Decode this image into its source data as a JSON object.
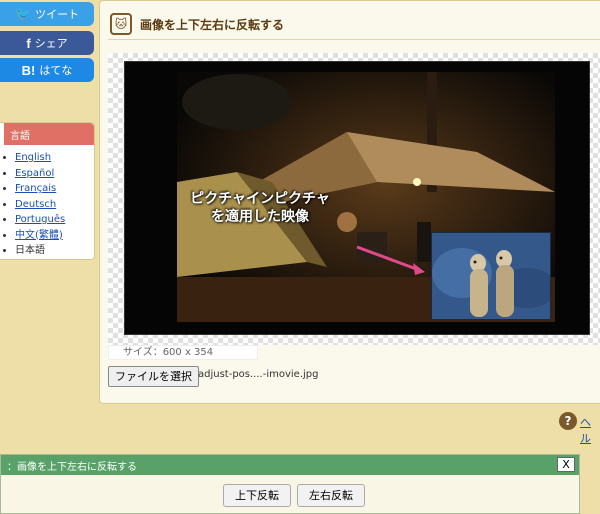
{
  "social": {
    "tweet": "ツイート",
    "share": "シェア",
    "hatena": "はてな"
  },
  "language": {
    "heading": "言語",
    "items": [
      "English",
      "Español",
      "Français",
      "Deutsch",
      "Português",
      "中文(繁體)",
      "日本語"
    ]
  },
  "panel": {
    "title": "画像を上下左右に反転する"
  },
  "preview": {
    "caption_line1": "ピクチャインピクチャ",
    "caption_line2": "を適用した映像",
    "size_label": "サイズ：600 x 354"
  },
  "file": {
    "button_label": "ファイルを選択",
    "file_name": "adjust-pos....-imovie.jpg"
  },
  "help": {
    "icon": "?",
    "link_text": "ヘル"
  },
  "dialog": {
    "title": "：画像を上下左右に反転する",
    "close_label": "X",
    "flip_vertical_label": "上下反転",
    "flip_horizontal_label": "左右反転"
  },
  "colors": {
    "background": "#eedfa8",
    "twitter": "#3aa0e8",
    "facebook": "#3b5998",
    "hatena": "#1e88e5",
    "language_header": "#e07065",
    "dialog_header": "#58a26a"
  }
}
